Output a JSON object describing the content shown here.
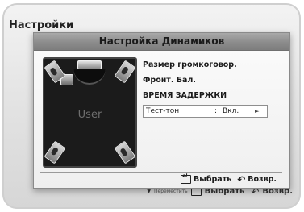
{
  "screen": {
    "title": "Настройки",
    "footer": {
      "move_label": "Переместить",
      "select_label": "Выбрать",
      "return_label": "Возвр."
    }
  },
  "dialog": {
    "title": "Настройка Динамиков",
    "speaker_panel": {
      "mode_label": "User"
    },
    "menu": {
      "items": [
        {
          "label": "Размер громкоговор."
        },
        {
          "label": "Фронт. Бал."
        },
        {
          "label": "ВРЕМЯ ЗАДЕРЖКИ"
        }
      ],
      "selected": {
        "label": "Тест-тон",
        "separator": ":",
        "value": "Вкл.",
        "arrow": "►"
      }
    },
    "footer": {
      "select_label": "Выбрать",
      "return_label": "Возвр.",
      "return_glyph": "↶"
    }
  },
  "colors": {
    "dialog_title_bar": "#8c8c8c",
    "speaker_panel_bg": "#1b1b1b",
    "selection_border": "#8e8e8e"
  }
}
